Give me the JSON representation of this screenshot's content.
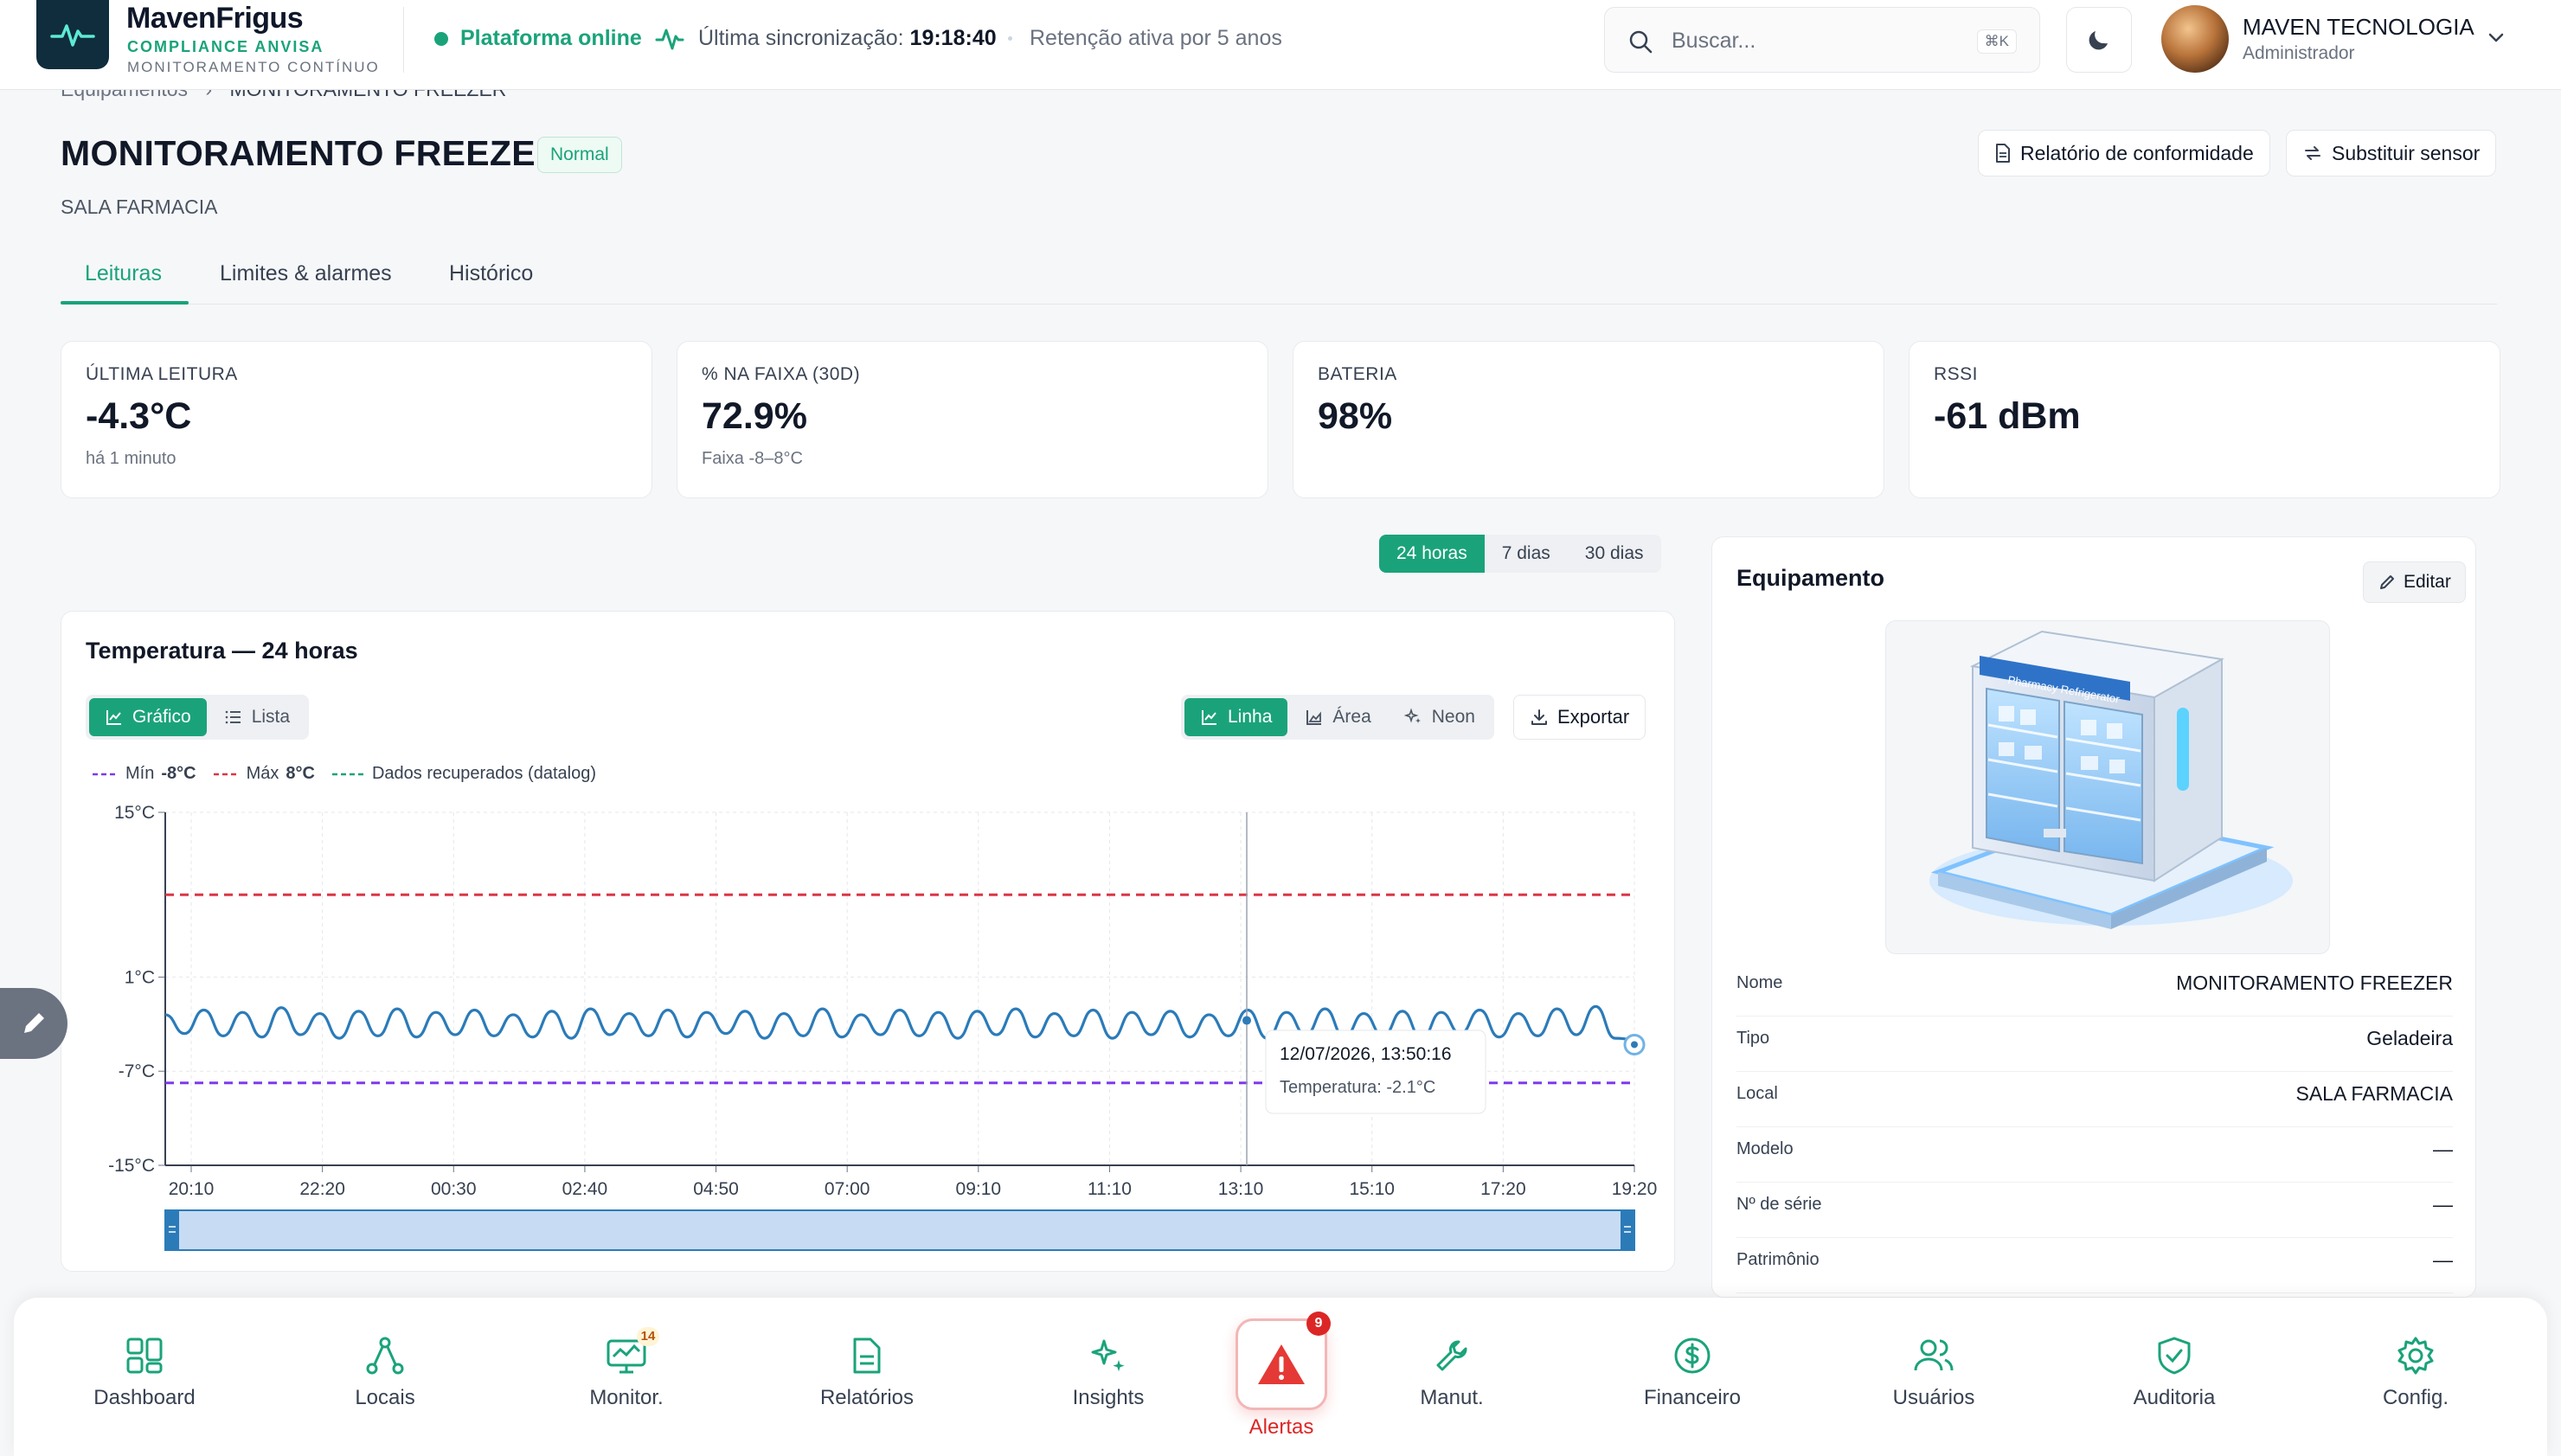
{
  "header": {
    "brand": "MavenFrigus",
    "brand_sub1": "COMPLIANCE ANVISA",
    "brand_sub2": "MONITORAMENTO CONTÍNUO",
    "status": "Plataforma online",
    "sync_label": "Última sincronização:",
    "sync_time": "19:18:40",
    "retention": "Retenção ativa por 5 anos",
    "search_placeholder": "Buscar...",
    "search_shortcut": "⌘K",
    "user_name": "MAVEN TECNOLOGIA",
    "user_role": "Administrador"
  },
  "breadcrumb": {
    "parent": "Equipamentos",
    "current": "MONITORAMENTO FREEZER"
  },
  "page": {
    "title": "MONITORAMENTO FREEZER",
    "badge": "Normal",
    "subtitle": "SALA FARMACIA",
    "report_button": "Relatório de conformidade",
    "replace_button": "Substituir sensor"
  },
  "tabs": [
    "Leituras",
    "Limites & alarmes",
    "Histórico"
  ],
  "kpis": [
    {
      "label": "ÚLTIMA LEITURA",
      "value": "-4.3°C",
      "foot": "há 1 minuto"
    },
    {
      "label": "% NA FAIXA (30D)",
      "value": "72.9%",
      "foot": "Faixa -8–8°C"
    },
    {
      "label": "BATERIA",
      "value": "98%",
      "foot": ""
    },
    {
      "label": "RSSI",
      "value": "-61 dBm",
      "foot": ""
    }
  ],
  "range_options": [
    "24 horas",
    "7 dias",
    "30 dias"
  ],
  "chart_card": {
    "title": "Temperatura — 24 horas",
    "view_grafico": "Gráfico",
    "view_lista": "Lista",
    "mode_linha": "Linha",
    "mode_area": "Área",
    "mode_neon": "Neon",
    "export": "Exportar",
    "legend_min_label": "Mín",
    "legend_min_value": "-8°C",
    "legend_max_label": "Máx",
    "legend_max_value": "8°C",
    "legend_recovered": "Dados recuperados (datalog)",
    "tooltip_time": "12/07/2026, 13:50:16",
    "tooltip_label": "Temperatura:",
    "tooltip_value": "-2.1°C"
  },
  "chart_data": {
    "type": "line",
    "title": "Temperatura — 24 horas",
    "xlabel": "",
    "ylabel": "",
    "x_ticks": [
      "20:10",
      "22:20",
      "00:30",
      "02:40",
      "04:50",
      "07:00",
      "09:10",
      "11:10",
      "13:10",
      "15:10",
      "17:20",
      "19:20"
    ],
    "y_ticks": [
      15,
      1,
      -7,
      -15
    ],
    "y_tick_labels": [
      "15°C",
      "1°C",
      "-7°C",
      "-15°C"
    ],
    "ylim": [
      -15,
      15
    ],
    "grid": true,
    "thresholds": [
      {
        "name": "Máx",
        "value": 8,
        "color": "#dc3545"
      },
      {
        "name": "Mín",
        "value": -8,
        "color": "#7c3aed"
      }
    ],
    "series": [
      {
        "color": "#2b7bb9",
        "values": [
          -2.2,
          -3.8,
          -1.8,
          -4.0,
          -2.0,
          -4.1,
          -1.6,
          -3.9,
          -2.1,
          -4.2,
          -1.9,
          -4.0,
          -1.7,
          -4.1,
          -2.0,
          -3.9,
          -1.8,
          -4.0,
          -2.2,
          -4.1,
          -1.9,
          -4.2,
          -1.7,
          -3.9,
          -2.1,
          -4.0,
          -1.8,
          -4.1,
          -2.0,
          -3.8,
          -1.9,
          -4.2,
          -2.1,
          -4.0,
          -1.7,
          -4.1,
          -2.2,
          -3.9,
          -1.8,
          -4.0,
          -2.0,
          -4.2,
          -1.9,
          -3.9,
          -1.7,
          -4.1,
          -2.1,
          -4.0,
          -1.8,
          -4.2,
          -2.0,
          -3.9,
          -1.9,
          -4.1,
          -2.2,
          -4.0,
          -1.8,
          -4.2,
          -2.0,
          -3.9,
          -1.7,
          -4.1,
          -2.1,
          -4.0,
          -1.9,
          -4.2,
          -2.0,
          -3.8,
          -1.8,
          -4.1,
          -2.1,
          -4.0,
          -1.7,
          -3.9,
          -1.5,
          -4.2,
          -4.3
        ]
      }
    ],
    "tooltip": {
      "time": "12/07/2026, 13:50:16",
      "value": -2.1
    },
    "colors": {
      "line": "#2b7bb9",
      "max": "#dc3545",
      "min": "#7c3aed",
      "recovered": "#1aa37a"
    }
  },
  "equipment": {
    "title": "Equipamento",
    "edit": "Editar",
    "image_label": "Pharmacy Refrigerator",
    "rows": [
      {
        "k": "Nome",
        "v": "MONITORAMENTO FREEZER"
      },
      {
        "k": "Tipo",
        "v": "Geladeira"
      },
      {
        "k": "Local",
        "v": "SALA FARMACIA"
      },
      {
        "k": "Modelo",
        "v": "—"
      },
      {
        "k": "Nº de série",
        "v": "—"
      },
      {
        "k": "Patrimônio",
        "v": "—"
      }
    ]
  },
  "nav": {
    "items": [
      "Dashboard",
      "Locais",
      "Monitor.",
      "Relatórios",
      "Insights",
      "Manut.",
      "Financeiro",
      "Usuários",
      "Auditoria",
      "Config."
    ],
    "monitor_badge": "14",
    "alerts_label": "Alertas",
    "alerts_badge": "9"
  },
  "colors": {
    "accent": "#1aa37a",
    "danger": "#dc2626",
    "brand_dark": "#0f2d3d"
  }
}
